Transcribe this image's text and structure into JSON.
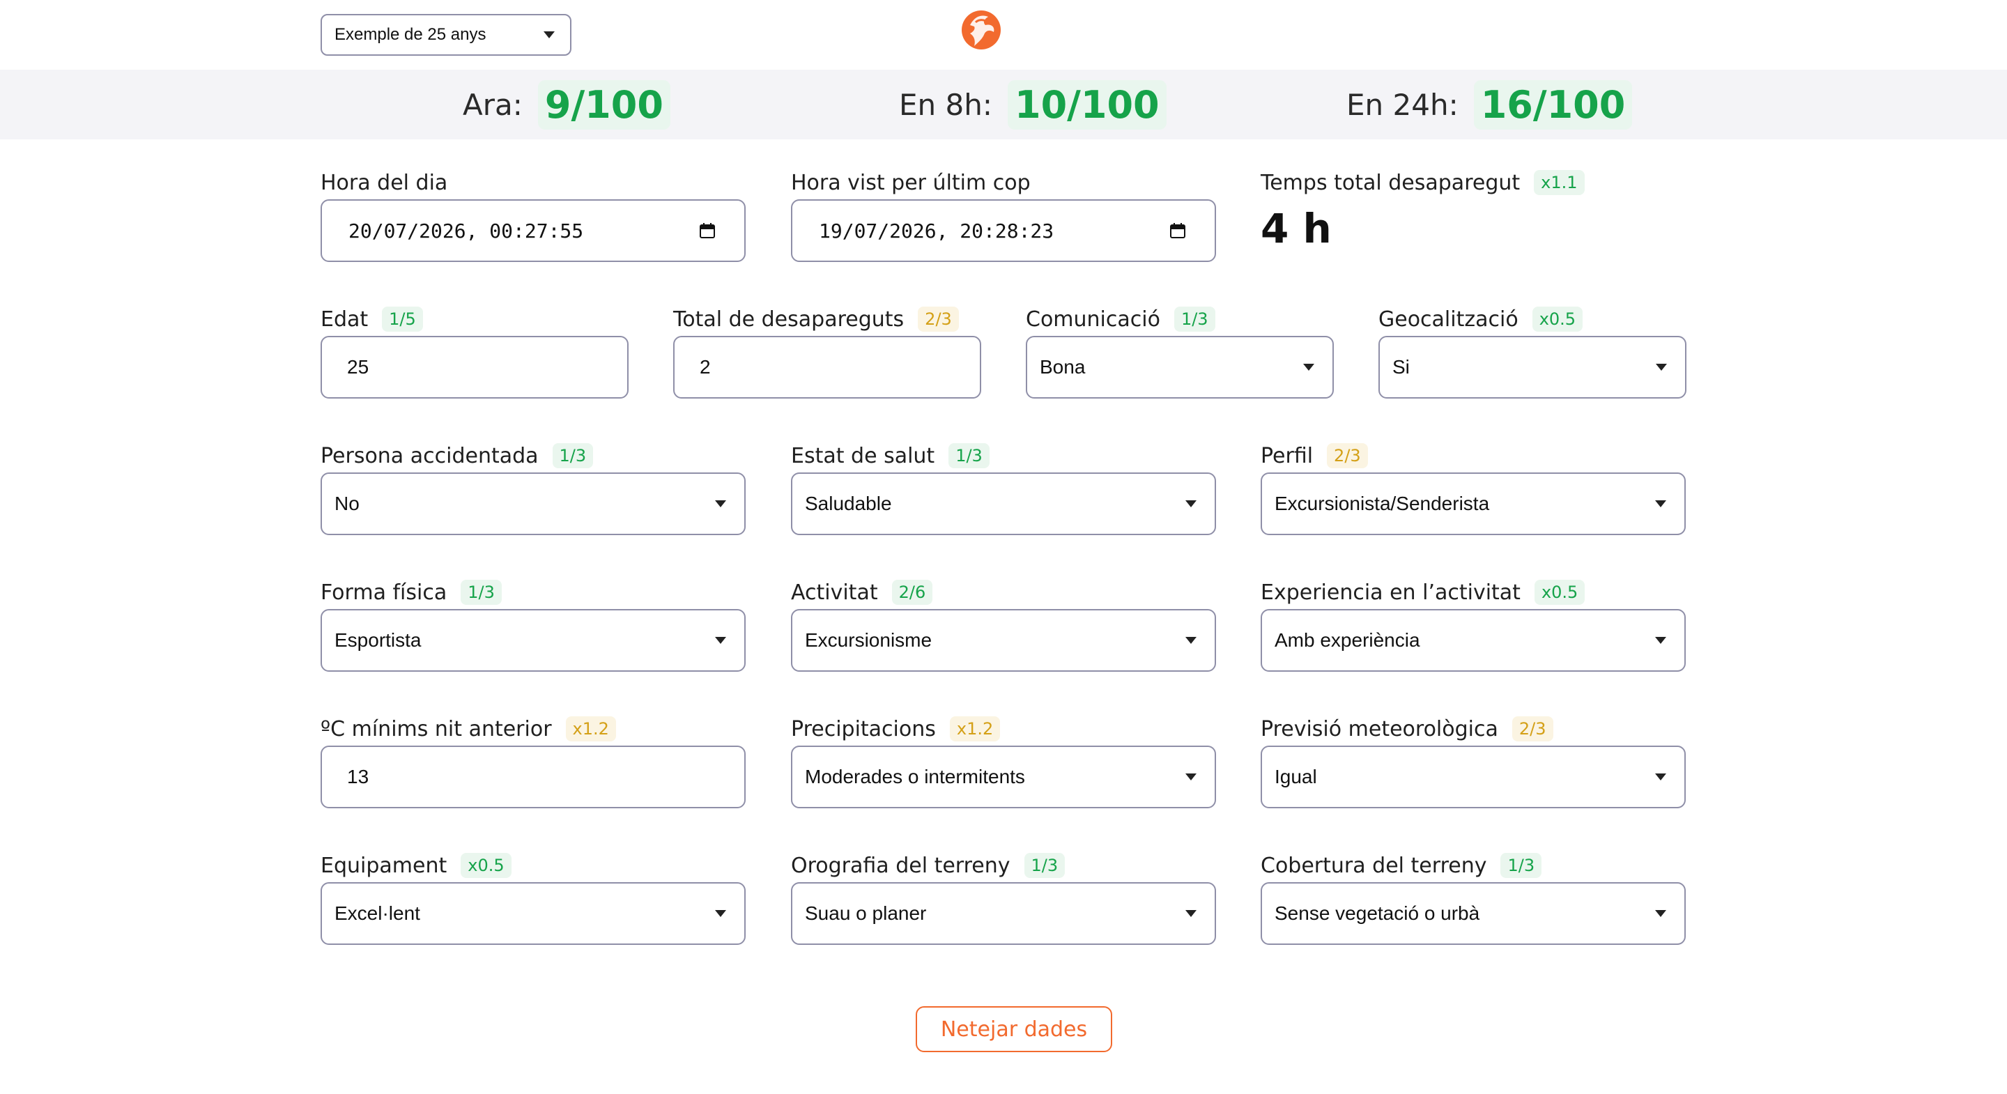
{
  "header": {
    "example_select": "Exemple de 25 anys",
    "logo_icon": "eagle-logo-icon",
    "brand_color": "#f26a2e"
  },
  "scores": [
    {
      "label": "Ara:",
      "value": "9/100"
    },
    {
      "label": "En 8h:",
      "value": "10/100"
    },
    {
      "label": "En 24h:",
      "value": "16/100"
    }
  ],
  "colors": {
    "good": "#16a34a",
    "medium": "#d4a017",
    "accent": "#f26a2e"
  },
  "form": {
    "hora_dia": {
      "label": "Hora del dia",
      "value": "20/07/2026, 00:27:55"
    },
    "hora_vist": {
      "label": "Hora vist per últim cop",
      "value": "19/07/2026, 20:28:23"
    },
    "temps_total": {
      "label": "Temps total desaparegut",
      "badge": "x1.1",
      "value": "4 h"
    },
    "edat": {
      "label": "Edat",
      "badge": "1/5",
      "value": "25"
    },
    "total_desapareguts": {
      "label": "Total de desapareguts",
      "badge": "2/3",
      "value": "2"
    },
    "comunicacio": {
      "label": "Comunicació",
      "badge": "1/3",
      "value": "Bona"
    },
    "geocalitzacio": {
      "label": "Geocalització",
      "badge": "x0.5",
      "value": "Si"
    },
    "persona_accidentada": {
      "label": "Persona accidentada",
      "badge": "1/3",
      "value": "No"
    },
    "estat_salut": {
      "label": "Estat de salut",
      "badge": "1/3",
      "value": "Saludable"
    },
    "perfil": {
      "label": "Perfil",
      "badge": "2/3",
      "value": "Excursionista/Senderista"
    },
    "forma_fisica": {
      "label": "Forma física",
      "badge": "1/3",
      "value": "Esportista"
    },
    "activitat": {
      "label": "Activitat",
      "badge": "2/6",
      "value": "Excursionisme"
    },
    "experiencia": {
      "label": "Experiencia en l’activitat",
      "badge": "x0.5",
      "value": "Amb experiència"
    },
    "temp_minima": {
      "label": "ºC mínims nit anterior",
      "badge": "x1.2",
      "value": "13"
    },
    "precipitacions": {
      "label": "Precipitacions",
      "badge": "x1.2",
      "value": "Moderades o intermitents"
    },
    "previsio": {
      "label": "Previsió meteorològica",
      "badge": "2/3",
      "value": "Igual"
    },
    "equipament": {
      "label": "Equipament",
      "badge": "x0.5",
      "value": "Excel·lent"
    },
    "orografia": {
      "label": "Orografia del terreny",
      "badge": "1/3",
      "value": "Suau o planer"
    },
    "cobertura": {
      "label": "Cobertura del terreny",
      "badge": "1/3",
      "value": "Sense vegetació o urbà"
    }
  },
  "actions": {
    "clear_label": "Netejar dades"
  }
}
